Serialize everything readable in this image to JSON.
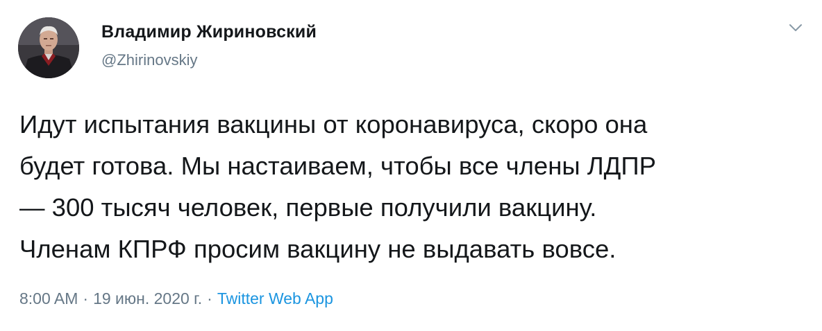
{
  "author": {
    "name": "Владимир Жириновский",
    "handle": "@Zhirinovskiy"
  },
  "tweet": {
    "lines": [
      "Идут испытания вакцины от коронавируса, скоро она",
      "будет готова. Мы настаиваем, чтобы все члены ЛДПР",
      "— 300 тысяч человек, первые получили вакцину.",
      "Членам КПРФ просим вакцину не выдавать вовсе."
    ]
  },
  "meta": {
    "time": "8:00 AM",
    "separator": "·",
    "date": "19 июн. 2020 г.",
    "source": "Twitter Web App"
  },
  "icons": {
    "menu": "chevron-down-icon",
    "avatar": "profile-photo"
  },
  "colors": {
    "text": "#14171a",
    "secondary": "#657786",
    "link": "#1b95e0"
  }
}
